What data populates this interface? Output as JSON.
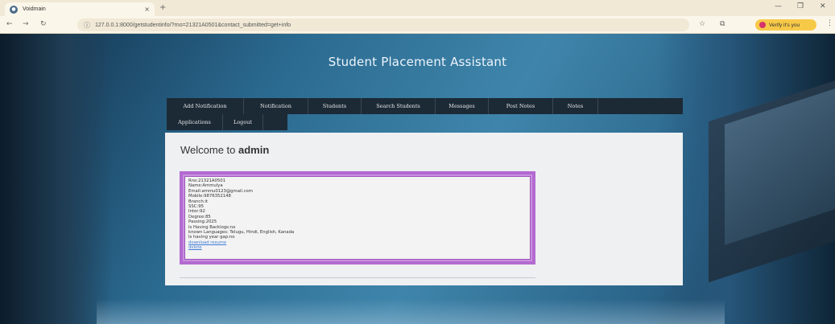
{
  "browser": {
    "tab_title": "Voidmain",
    "tab_close": "×",
    "new_tab": "+",
    "url": "127.0.0.1:8000/getstudentinfo/?rno=21321A0501&contact_submitted=get+info",
    "verify_label": "Verify it's you",
    "controls": {
      "minimize": "—",
      "restore": "❐",
      "close": "✕"
    }
  },
  "site": {
    "title": "Student Placement Assistant"
  },
  "nav": {
    "row1": [
      {
        "label": "Add Notification",
        "width": 96
      },
      {
        "label": "Notification",
        "width": 80
      },
      {
        "label": "Students",
        "width": 66
      },
      {
        "label": "Search Students",
        "width": 92
      },
      {
        "label": "Messages",
        "width": 66
      },
      {
        "label": "Post Notes",
        "width": 80
      },
      {
        "label": "Notes",
        "width": 56
      }
    ],
    "row2": [
      {
        "label": "Applications",
        "width": 70
      },
      {
        "label": "Logout",
        "width": 50
      }
    ]
  },
  "main": {
    "welcome_prefix": "Welcome to ",
    "welcome_user": "admin",
    "student_info": [
      "Rno:21321A0501",
      "Name:Ammulya",
      "Email:ammu0123@gmail.com",
      "Mobile:9876352148",
      "Branch:it",
      "SSC:95",
      "Inter:92",
      "Degree:85",
      "Passing:2025",
      "Is Having Backlogs:no",
      "known Languages: Telugu, Hindi, English, Kanada",
      "Is having year gap:no"
    ],
    "links": {
      "download_resume": "download resume",
      "delete": "delete"
    }
  }
}
